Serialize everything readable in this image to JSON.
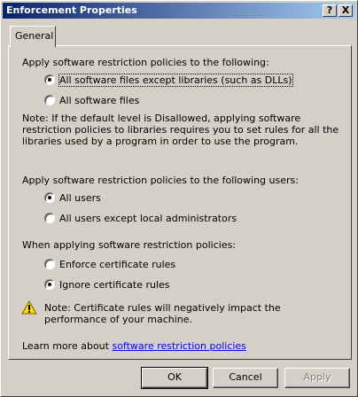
{
  "window": {
    "title": "Enforcement Properties",
    "help_button": "?",
    "close_button": "X"
  },
  "tabs": [
    {
      "label": "General"
    }
  ],
  "section1": {
    "heading": "Apply software restriction policies to the following:",
    "options": [
      {
        "label": "All software files except libraries (such as DLLs)",
        "selected": true
      },
      {
        "label": "All software files",
        "selected": false
      }
    ],
    "note": "Note:  If the default level is Disallowed, applying software restriction policies to libraries requires you to set rules for all the libraries used by a program in order to use the program."
  },
  "section2": {
    "heading": "Apply software restriction policies to the following users:",
    "options": [
      {
        "label": "All users",
        "selected": true
      },
      {
        "label": "All users except local administrators",
        "selected": false
      }
    ]
  },
  "section3": {
    "heading": "When applying software restriction policies:",
    "options": [
      {
        "label": "Enforce certificate rules",
        "selected": false
      },
      {
        "label": "Ignore certificate rules",
        "selected": true
      }
    ],
    "warning": "Note:  Certificate rules will negatively impact the performance of your machine.",
    "warning_icon": "warning-icon"
  },
  "learn_more": {
    "prefix": "Learn more about ",
    "link": "software restriction policies"
  },
  "buttons": {
    "ok": "OK",
    "cancel": "Cancel",
    "apply": "Apply"
  }
}
